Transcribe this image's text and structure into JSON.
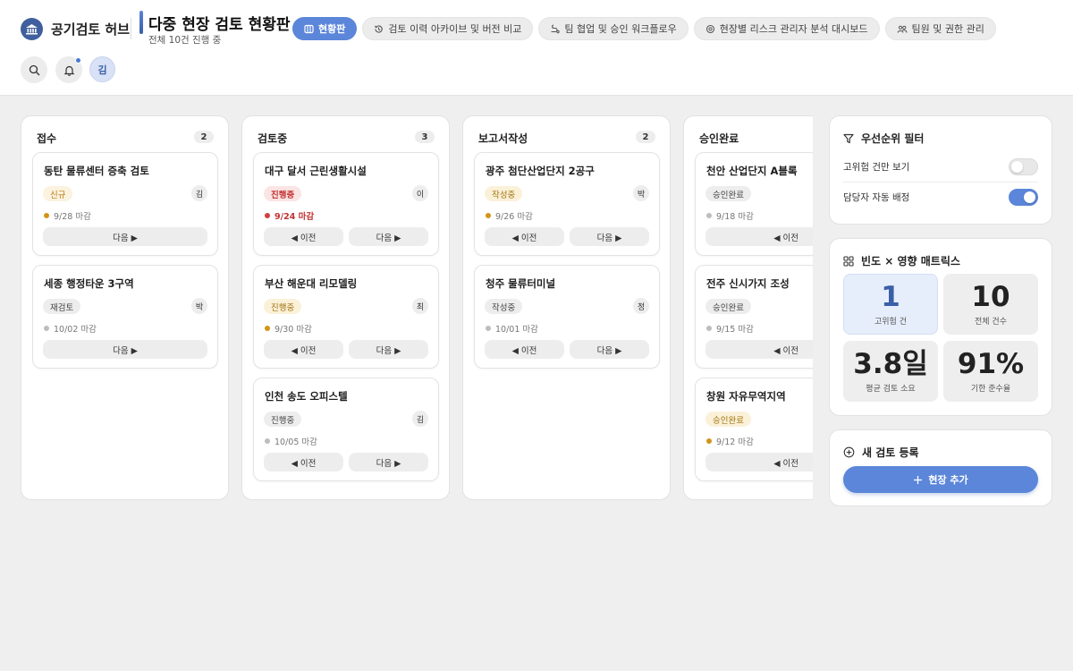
{
  "app": {
    "name": "공기검토 허브"
  },
  "page": {
    "title": "다중 현장 검토 현황판",
    "subtitle": "전체 10건 진행 중"
  },
  "tabs": [
    {
      "label": "현황판",
      "icon": "board-icon",
      "active": true
    },
    {
      "label": "검토 이력 아카이브 및 버전 비교",
      "icon": "history-icon",
      "active": false
    },
    {
      "label": "팀 협업 및 승인 워크플로우",
      "icon": "workflow-icon",
      "active": false
    },
    {
      "label": "현장별 리스크 관리자 분석 대시보드",
      "icon": "risk-icon",
      "active": false
    },
    {
      "label": "팀원 및 권한 관리",
      "icon": "team-icon",
      "active": false
    }
  ],
  "header": {
    "avatar": "김"
  },
  "columns": [
    {
      "title": "접수",
      "count": "2",
      "cards": [
        {
          "title": "동탄 물류센터 증축 검토",
          "status": "신규",
          "assignee": "김",
          "due": "9/28 마감",
          "dot": "#d39417",
          "next": "다음 ▶"
        },
        {
          "title": "세종 행정타운 3구역",
          "status": "재검토",
          "assignee": "박",
          "due": "10/02 마감",
          "dot": "#bdbdbd",
          "next": "다음 ▶"
        }
      ]
    },
    {
      "title": "검토중",
      "count": "3",
      "cards": [
        {
          "title": "대구 달서 근린생활시설",
          "status": "진행중",
          "assignee": "이",
          "due": "9/24 마감",
          "dot": "#d23f3f",
          "prev": "◀ 이전",
          "next": "다음 ▶"
        },
        {
          "title": "부산 해운대 리모델링",
          "status": "진행중",
          "assignee": "최",
          "due": "9/30 마감",
          "dot": "#d39417",
          "prev": "◀ 이전",
          "next": "다음 ▶"
        },
        {
          "title": "인천 송도 오피스텔",
          "status": "진행중",
          "assignee": "김",
          "due": "10/05 마감",
          "dot": "#bdbdbd",
          "prev": "◀ 이전",
          "next": "다음 ▶"
        }
      ]
    },
    {
      "title": "보고서작성",
      "count": "2",
      "cards": [
        {
          "title": "광주 첨단산업단지 2공구",
          "status": "작성중",
          "assignee": "박",
          "due": "9/26 마감",
          "dot": "#d39417",
          "prev": "◀ 이전",
          "next": "다음 ▶"
        },
        {
          "title": "청주 물류터미널",
          "status": "작성중",
          "assignee": "정",
          "due": "10/01 마감",
          "dot": "#bdbdbd",
          "prev": "◀ 이전",
          "next": "다음 ▶"
        }
      ]
    },
    {
      "title": "승인완료",
      "count": "",
      "cards": [
        {
          "title": "천안 산업단지 A블록",
          "status": "승인완료",
          "due": "9/18 마감",
          "dot": "#bdbdbd",
          "prev": "◀ 이전"
        },
        {
          "title": "전주 신시가지 조성",
          "status": "승인완료",
          "due": "9/15 마감",
          "dot": "#bdbdbd",
          "prev": "◀ 이전"
        },
        {
          "title": "창원 자유무역지역",
          "status": "승인완료",
          "due": "9/12 마감",
          "dot": "#d39417",
          "prev": "◀ 이전"
        }
      ]
    }
  ],
  "filter": {
    "title": "우선순위 필터",
    "high_risk_label": "고위험 건만 보기",
    "high_risk_on": false,
    "auto_assign_label": "담당자 자동 배정",
    "auto_assign_on": true
  },
  "matrix": {
    "title": "빈도 × 영향 매트릭스",
    "metrics": [
      {
        "value": "1",
        "label": "고위험 건"
      },
      {
        "value": "10",
        "label": "전체 건수"
      },
      {
        "value": "3.8일",
        "label": "평균 검토 소요"
      },
      {
        "value": "91%",
        "label": "기한 준수율"
      }
    ]
  },
  "new_review": {
    "title": "새 검토 등록",
    "button": "현장 추가"
  },
  "colors": {
    "accent": "#5b86d9",
    "brand": "#3f5f9e",
    "urgent": "#d23f3f",
    "warning": "#d39417"
  }
}
